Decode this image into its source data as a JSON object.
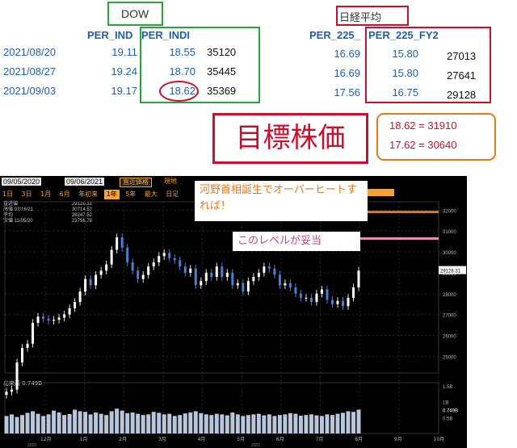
{
  "dow_table": {
    "title": "DOW",
    "headers": [
      "PER_IND",
      "PER_INDI"
    ],
    "dates": [
      "2021/08/20",
      "2021/08/27",
      "2021/09/03"
    ],
    "col1": [
      "19.11",
      "19.24",
      "19.17"
    ],
    "col2": [
      "18.55",
      "18.70",
      "18.62"
    ],
    "col3": [
      "35120",
      "35445",
      "35369"
    ]
  },
  "nikkei_table": {
    "title": "日経平均",
    "headers": [
      "PER_225_",
      "PER_225_FY2"
    ],
    "col1": [
      "16.69",
      "16.69",
      "17.56"
    ],
    "col2": [
      "15.80",
      "15.80",
      "16.75"
    ],
    "col3": [
      "27013",
      "27641",
      "29128"
    ]
  },
  "target": {
    "label": "目標株価",
    "line1": "18.62 = 31910",
    "line2": "17.62 = 30640"
  },
  "chart_header": {
    "date_from": "09/05/2020",
    "date_to": "09/06/2021",
    "price_type": "直近価格",
    "current": "現地",
    "tabs": [
      "1日",
      "3日",
      "1月",
      "6月",
      "年初来",
      "1年",
      "5年",
      "最大",
      "日足"
    ],
    "active_tab": "1年"
  },
  "legend": {
    "lines": [
      "直近値",
      "高値 02/16/21",
      "平均",
      "安値 11/05/20"
    ],
    "values": [
      "29128.31",
      "30714.52",
      "28247.52",
      "23756.78"
    ]
  },
  "volume_label": "出来高",
  "volume_value": "0.749B",
  "annotations": {
    "orange": "河野首相誕生でオーバーヒートすれば！",
    "pink": "このレベルが妥当"
  },
  "colors": {
    "green": "#2aa33a",
    "red": "#c8102e",
    "orange": "#e07a1f",
    "pink": "#e58fb3",
    "candle_up": "#ffffff",
    "candle_down": "#4a7fd4",
    "volume": "#b9c7dd"
  },
  "chart_data": {
    "type": "line",
    "title": "",
    "x_ticks": [
      "12月",
      "1月",
      "2月",
      "3月",
      "4月",
      "5月",
      "6月",
      "7月",
      "8月",
      "9月",
      "10月"
    ],
    "x_sub": [
      "2020",
      "2021"
    ],
    "y_ticks": [
      "32000",
      "31000",
      "30000",
      "29000",
      "28000",
      "27000",
      "26000",
      "25000"
    ],
    "ylim": [
      24200,
      32400
    ],
    "last_price": "29128.31",
    "series": [
      {
        "values": [
          23300,
          23400,
          24700,
          25400,
          25600,
          26600,
          26900,
          26800,
          26700,
          26750,
          26850,
          27000,
          27300,
          27600,
          28100,
          28700,
          28400,
          28900,
          29100,
          29400,
          30100,
          30700,
          30200,
          29500,
          29100,
          28700,
          28900,
          29300,
          29500,
          29800,
          29950,
          29700,
          29600,
          29300,
          29000,
          29200,
          28400,
          28600,
          29000,
          28800,
          29300,
          28800,
          29000,
          28400,
          28500,
          28100,
          28600,
          28800,
          29000,
          29300,
          29200,
          28900,
          28400,
          28500,
          28300,
          28000,
          27800,
          27800,
          27600,
          28000,
          28200,
          27700,
          27500,
          27650,
          27400,
          27800,
          28300,
          29100
        ]
      }
    ],
    "volume_ticks": [
      "1.5B",
      "1B",
      "0.749B",
      "0.5B"
    ],
    "volume_ylim": [
      0,
      1.6
    ],
    "volume": [
      0.55,
      0.6,
      0.52,
      0.58,
      0.65,
      0.7,
      0.62,
      0.55,
      0.6,
      0.72,
      0.66,
      0.58,
      0.61,
      0.75,
      0.7,
      0.68,
      0.6,
      0.66,
      0.62,
      0.58,
      0.7,
      0.78,
      0.72,
      0.64,
      0.66,
      0.62,
      0.58,
      0.6,
      0.68,
      0.65,
      0.6,
      0.62,
      0.55,
      0.58,
      0.63,
      0.66,
      0.7,
      0.64,
      0.6,
      0.58,
      0.62,
      0.6,
      0.57,
      0.66,
      0.6,
      0.55,
      0.58,
      0.6,
      0.62,
      0.57,
      0.6,
      0.55,
      0.58,
      0.6,
      0.64,
      0.62,
      0.56,
      0.58,
      0.6,
      0.57,
      0.55,
      0.6,
      0.58,
      0.62,
      0.65,
      0.7,
      0.68,
      0.75
    ],
    "hlines": [
      {
        "value": 31910,
        "color": "orange"
      },
      {
        "value": 30640,
        "color": "pink"
      }
    ]
  }
}
